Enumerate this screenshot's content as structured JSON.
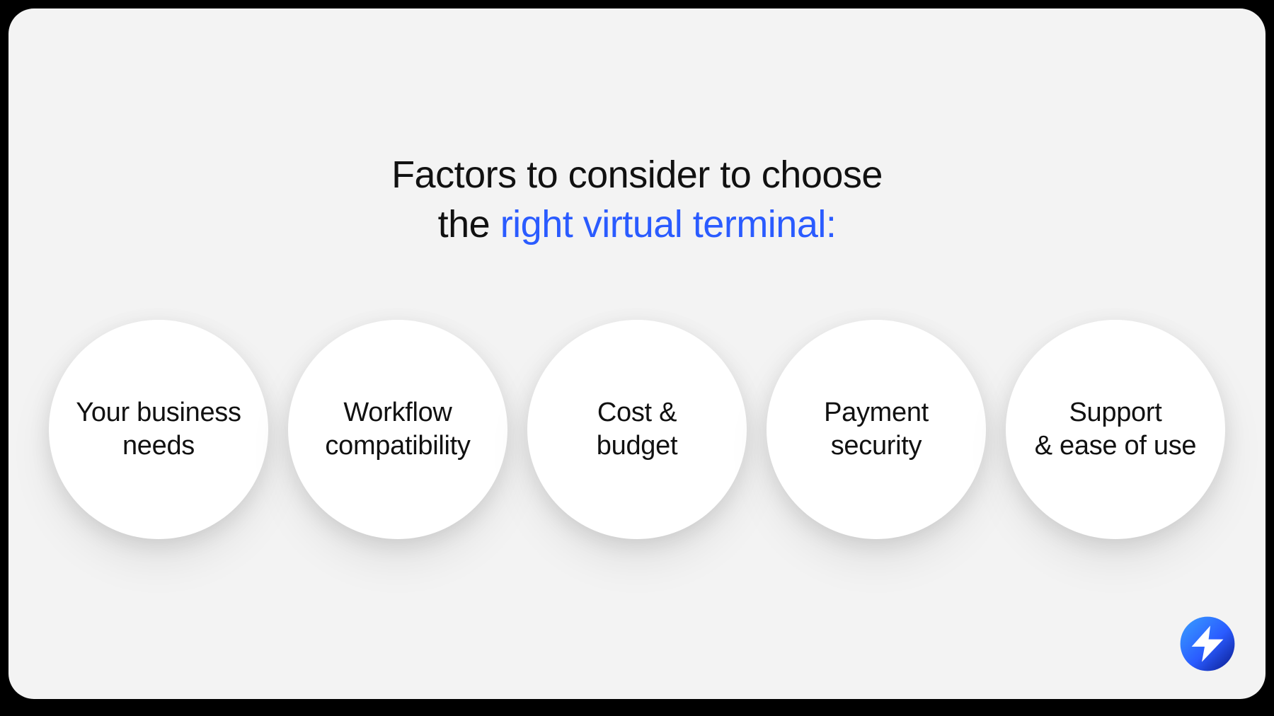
{
  "heading": {
    "line1": "Factors to consider to choose",
    "line2_prefix": "the ",
    "line2_accent": "right virtual terminal:"
  },
  "factors": [
    {
      "label": "Your business\nneeds"
    },
    {
      "label": "Workflow\ncompatibility"
    },
    {
      "label": "Cost &\nbudget"
    },
    {
      "label": "Payment\nsecurity"
    },
    {
      "label": "Support\n& ease of use"
    }
  ],
  "brand": {
    "logo_name": "chargebee-bolt-logo"
  },
  "colors": {
    "accent": "#2a5bff"
  }
}
